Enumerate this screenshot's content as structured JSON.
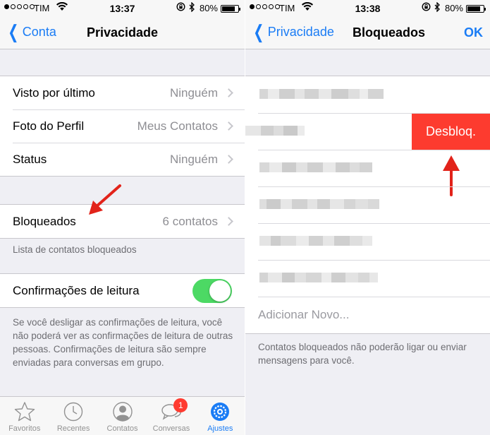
{
  "left": {
    "status": {
      "carrier": "TIM",
      "time": "13:37",
      "battery": "80%",
      "battery_level": 0.8
    },
    "nav": {
      "back_label": "Conta",
      "title": "Privacidade"
    },
    "privacy_rows": [
      {
        "label": "Visto por último",
        "value": "Ninguém"
      },
      {
        "label": "Foto do Perfil",
        "value": "Meus Contatos"
      },
      {
        "label": "Status",
        "value": "Ninguém"
      }
    ],
    "blocked_row": {
      "label": "Bloqueados",
      "value": "6 contatos"
    },
    "blocked_note": "Lista de contatos bloqueados",
    "read_receipts": {
      "label": "Confirmações de leitura",
      "on": true
    },
    "read_receipts_note": "Se você desligar as confirmações de leitura, você não poderá ver as confirmações de leitura de outras pessoas. Confirmações de leitura são sempre enviadas para conversas em grupo.",
    "tabs": [
      {
        "label": "Favoritos",
        "icon": "star-icon"
      },
      {
        "label": "Recentes",
        "icon": "clock-icon"
      },
      {
        "label": "Contatos",
        "icon": "person-icon"
      },
      {
        "label": "Conversas",
        "icon": "chat-bubbles-icon",
        "badge": "1"
      },
      {
        "label": "Ajustes",
        "icon": "gear-icon",
        "active": true
      }
    ]
  },
  "right": {
    "status": {
      "carrier": "TIM",
      "time": "13:38",
      "battery": "80%",
      "battery_level": 0.8
    },
    "nav": {
      "back_label": "Privacidade",
      "title": "Bloqueados",
      "action_label": "OK"
    },
    "unblock_label": "Desbloq.",
    "add_new_label": "Adicionar Novo...",
    "footer_note": "Contatos bloqueados não poderão ligar ou enviar mensagens para você."
  },
  "colors": {
    "accent": "#1a7cf5",
    "toggle_on": "#4cd964",
    "destructive": "#fd3b2f",
    "badge": "#ff3b30",
    "annotation_arrow": "#e2231a"
  }
}
